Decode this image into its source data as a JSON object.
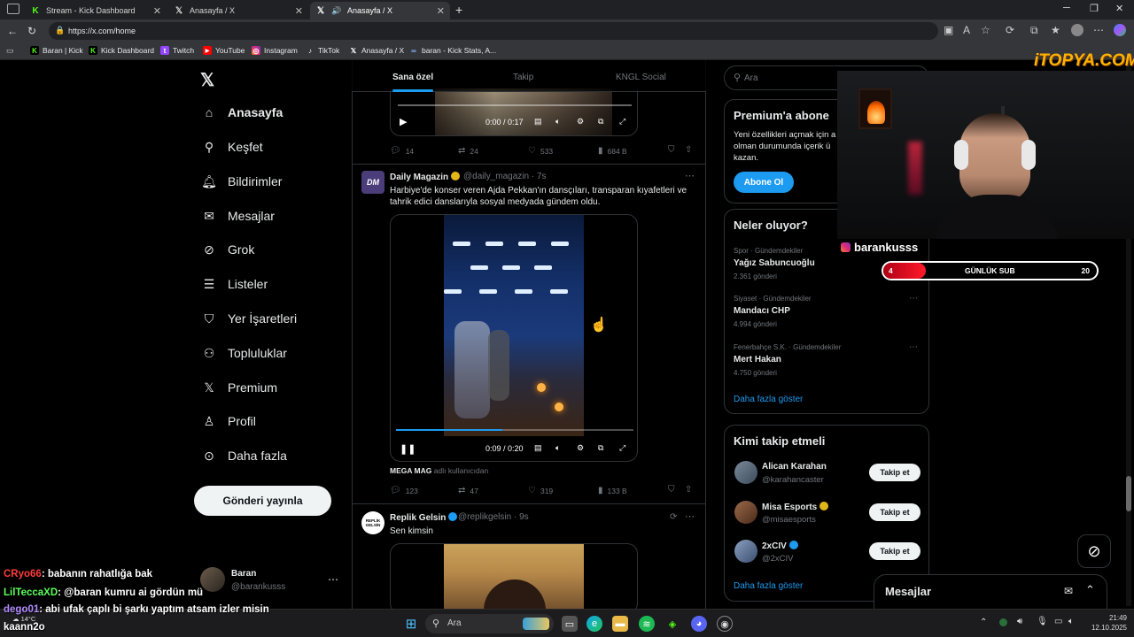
{
  "browser": {
    "tabs": [
      {
        "label": "Stream - Kick Dashboard",
        "icon": "kick-icon"
      },
      {
        "label": "Anasayfa / X",
        "icon": "x-logo-icon"
      },
      {
        "label": "Anasayfa / X",
        "icon": "x-logo-icon"
      }
    ],
    "url": "https://x.com/home",
    "bookmarks": [
      "Baran | Kick",
      "Kick Dashboard",
      "Twitch",
      "YouTube",
      "Instagram",
      "TikTok",
      "Anasayfa / X",
      "baran - Kick Stats, A..."
    ]
  },
  "sidebar": {
    "items": [
      {
        "label": "Anasayfa",
        "icon": "home-icon"
      },
      {
        "label": "Keşfet",
        "icon": "search-icon"
      },
      {
        "label": "Bildirimler",
        "icon": "bell-icon"
      },
      {
        "label": "Mesajlar",
        "icon": "mail-icon"
      },
      {
        "label": "Grok",
        "icon": "grok-icon"
      },
      {
        "label": "Listeler",
        "icon": "list-icon"
      },
      {
        "label": "Yer İşaretleri",
        "icon": "bookmark-icon"
      },
      {
        "label": "Topluluklar",
        "icon": "communities-icon"
      },
      {
        "label": "Premium",
        "icon": "x-logo-icon"
      },
      {
        "label": "Profil",
        "icon": "person-icon"
      },
      {
        "label": "Daha fazla",
        "icon": "more-icon"
      }
    ],
    "post_button": "Gönderi yayınla",
    "account": {
      "name": "Baran",
      "handle": "@barankusss"
    }
  },
  "feed": {
    "tabs": [
      "Sana özel",
      "Takip",
      "KNGL Social"
    ],
    "tweet0": {
      "video_time": "0:00 / 0:17",
      "replies": "14",
      "reposts": "24",
      "likes": "533",
      "views": "684 B"
    },
    "tweet1": {
      "name": "Daily Magazin",
      "handle": "@daily_magazin",
      "time": "7s",
      "avatar_text": "DM",
      "text": "Harbiye'de konser veren Ajda Pekkan'ın dansçıları, transparan kıyafetleri ve tahrik edici danslarıyla sosyal medyada gündem oldu.",
      "video_time": "0:09 / 0:20",
      "source_name": "MEGA MAG",
      "source_suffix": "adlı kullanıcıdan",
      "replies": "123",
      "reposts": "47",
      "likes": "319",
      "views": "133 B"
    },
    "tweet2": {
      "name": "Replik Gelsin",
      "handle": "@replikgelsin",
      "time": "9s",
      "avatar_text": "REPLİK GELSİN",
      "text": "Sen kimsin"
    }
  },
  "right": {
    "search_placeholder": "Ara",
    "premium": {
      "title": "Premium'a abone",
      "text": "Yeni özellikleri açmak için a olman durumunda içerik ü kazan.",
      "button": "Abone Ol"
    },
    "trends": {
      "title": "Neler oluyor?",
      "items": [
        {
          "meta": "Spor · Gündemdekiler",
          "name": "Yağız Sabuncuoğlu",
          "count": "2.361 gönderi"
        },
        {
          "meta": "Siyaset · Gündemdekiler",
          "name": "Mandacı CHP",
          "count": "4.994 gönderi"
        },
        {
          "meta": "Fenerbahçe S.K. · Gündemdekiler",
          "name": "Mert Hakan",
          "count": "4.750 gönderi"
        }
      ],
      "show_more": "Daha fazla göster"
    },
    "who_to_follow": {
      "title": "Kimi takip etmeli",
      "items": [
        {
          "name": "Alican Karahan",
          "handle": "@karahancaster",
          "button": "Takip et"
        },
        {
          "name": "Misa Esports",
          "handle": "@misaesports",
          "button": "Takip et"
        },
        {
          "name": "2xCIV",
          "handle": "@2xCIV",
          "button": "Takip et"
        }
      ],
      "show_more": "Daha fazla göster"
    },
    "messages_label": "Mesajlar"
  },
  "overlay": {
    "watermark": "iTOPYA.COM",
    "instagram_handle": "barankusss",
    "sub_goal": {
      "label": "GÜNLÜK SUB",
      "current": "4",
      "target": "20",
      "progress": 0.2
    },
    "chat": [
      {
        "user": "CRyo66",
        "message": ": babanın rahatlığa bak",
        "color": "#ff3b3b"
      },
      {
        "user": "LilTeccaXD",
        "message": ": @baran kumru ai gördün mü",
        "color": "#5cff5c"
      },
      {
        "user": "dego01",
        "message": ": abi ufak çaplı bi şarkı yaptım atsam izler misin",
        "color": "#b18cff"
      },
      {
        "user": "kaann2o",
        "message": "",
        "color": "#ffffff"
      }
    ]
  },
  "taskbar": {
    "search": "Ara",
    "weather": "14°C",
    "time": "21:49",
    "date": "12.10.2025"
  },
  "colors": {
    "accent": "#1d9bf0",
    "kick_green": "#53fc18",
    "background": "#000000"
  }
}
